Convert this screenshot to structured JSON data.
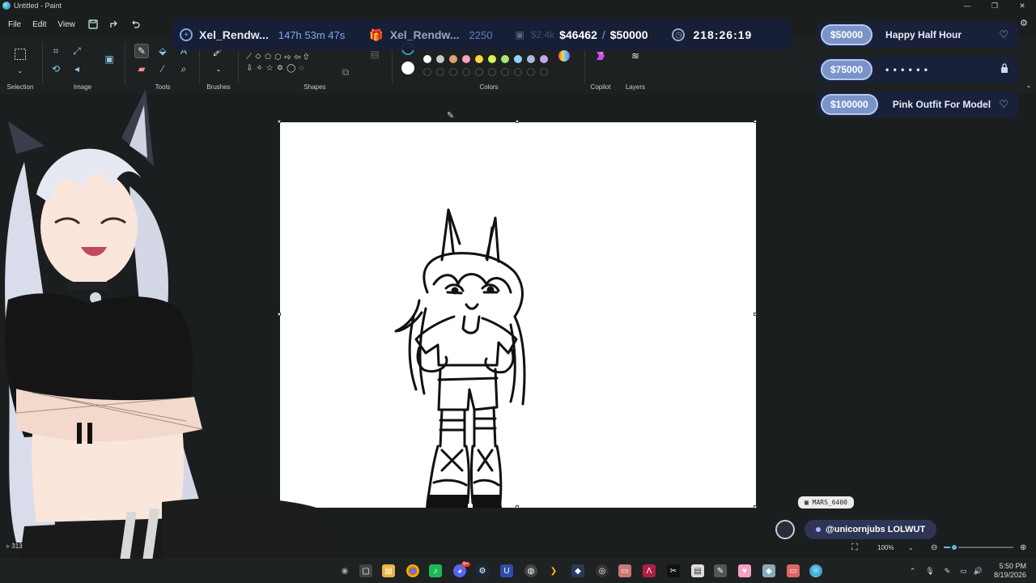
{
  "window": {
    "title": "Untitled - Paint",
    "controls": [
      "—",
      "❐",
      "✕"
    ]
  },
  "menu": {
    "items": [
      "File",
      "Edit",
      "View"
    ]
  },
  "ribbon": {
    "groups": {
      "selection": "Selection",
      "image": "Image",
      "tools": "Tools",
      "brushes": "Brushes",
      "shapes": "Shapes",
      "colors": "Colors",
      "copilot": "Copilot",
      "layers": "Layers"
    },
    "palette": [
      "#ffffff",
      "#c8c8c8",
      "#e2a07a",
      "#ff9fc1",
      "#ffd43b",
      "#d9ef5b",
      "#a8e86f",
      "#8fd3ff",
      "#a9b9e0",
      "#c7a4e8"
    ],
    "primary_color": "#1a1a1a",
    "secondary_color": "#ffffff"
  },
  "overlay": {
    "follower_name": "Xel_Rendw...",
    "follower_time": "147h 53m 47s",
    "sub_name": "Xel_Rendw...",
    "sub_count": "2250",
    "dim_amount": "$2.4k",
    "money_current": "$46462",
    "money_sep": "/",
    "money_goal": "$50000",
    "timer": "218:26:19"
  },
  "goals": [
    {
      "amount": "$50000",
      "label": "Happy Half Hour",
      "icon": "heart-icon",
      "glyph": "♡"
    },
    {
      "amount": "$75000",
      "label": "• • • • • •",
      "icon": "lock-icon",
      "glyph": "🔒"
    },
    {
      "amount": "$100000",
      "label": "Pink Outfit For Model",
      "icon": "heart-icon",
      "glyph": "♡"
    }
  ],
  "status": {
    "cursor_value": "313"
  },
  "chat": {
    "name_tag": "MARS_6400",
    "message": "@unicornjubs LOLWUT"
  },
  "zoom": {
    "level": "100%",
    "slider_fraction": 0.15
  },
  "taskbar": {
    "time": "5:50 PM",
    "date": "8/19/2026",
    "discord_badge": "9+"
  }
}
